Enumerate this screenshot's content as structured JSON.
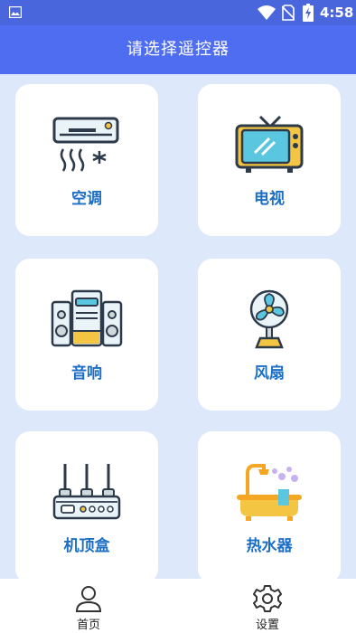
{
  "status_bar": {
    "time": "4:58",
    "icons": [
      "image-icon",
      "wifi-icon",
      "no-sim-icon",
      "battery-charging-icon"
    ]
  },
  "header": {
    "title": "请选择遥控器"
  },
  "devices": [
    {
      "label": "空调",
      "icon": "air-conditioner-icon"
    },
    {
      "label": "电视",
      "icon": "tv-icon"
    },
    {
      "label": "音响",
      "icon": "speaker-icon"
    },
    {
      "label": "风扇",
      "icon": "fan-icon"
    },
    {
      "label": "机顶盒",
      "icon": "set-top-box-icon"
    },
    {
      "label": "热水器",
      "icon": "water-heater-icon"
    }
  ],
  "bottom_nav": {
    "items": [
      {
        "label": "首页",
        "icon": "user-icon"
      },
      {
        "label": "设置",
        "icon": "gear-icon"
      }
    ]
  },
  "colors": {
    "status_bar": "#4a66dd",
    "header": "#4f6df0",
    "background": "#dde9fb",
    "card": "#ffffff",
    "label": "#1d6fc4"
  }
}
